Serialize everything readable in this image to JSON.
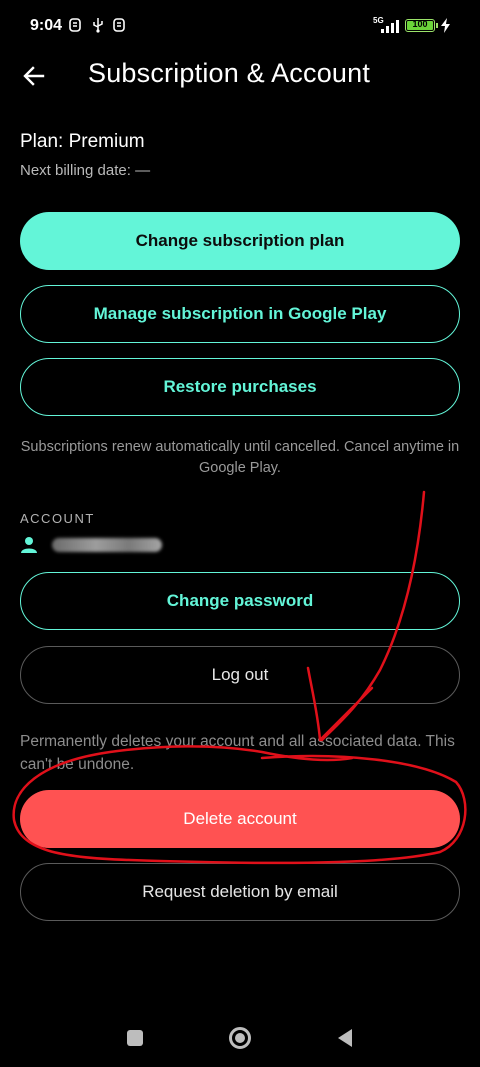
{
  "status_bar": {
    "time": "9:04",
    "network": "5G",
    "battery": "100"
  },
  "header": {
    "title": "Subscription & Account"
  },
  "subscription": {
    "plan": "Plan: Premium",
    "next_billing": "Next billing date: —",
    "change_plan_label": "Change subscription plan",
    "manage_label": "Manage subscription in Google Play",
    "restore_label": "Restore purchases",
    "info": "Subscriptions renew automatically until cancelled. Cancel anytime in Google Play."
  },
  "account": {
    "section_title": "ACCOUNT",
    "change_password_label": "Change password",
    "logout_label": "Log out",
    "delete_warning": "Permanently deletes your account and all associated data. This can't be undone.",
    "delete_label": "Delete account",
    "request_deletion_label": "Request deletion by email"
  },
  "colors": {
    "accent": "#63f5d8",
    "danger": "#ff5252",
    "background": "#000000",
    "annotation": "#e0101a"
  },
  "icons": {
    "back": "arrow-left-icon",
    "person": "person-icon",
    "nav_recents": "square-icon",
    "nav_home": "circle-icon",
    "nav_back": "triangle-icon"
  }
}
